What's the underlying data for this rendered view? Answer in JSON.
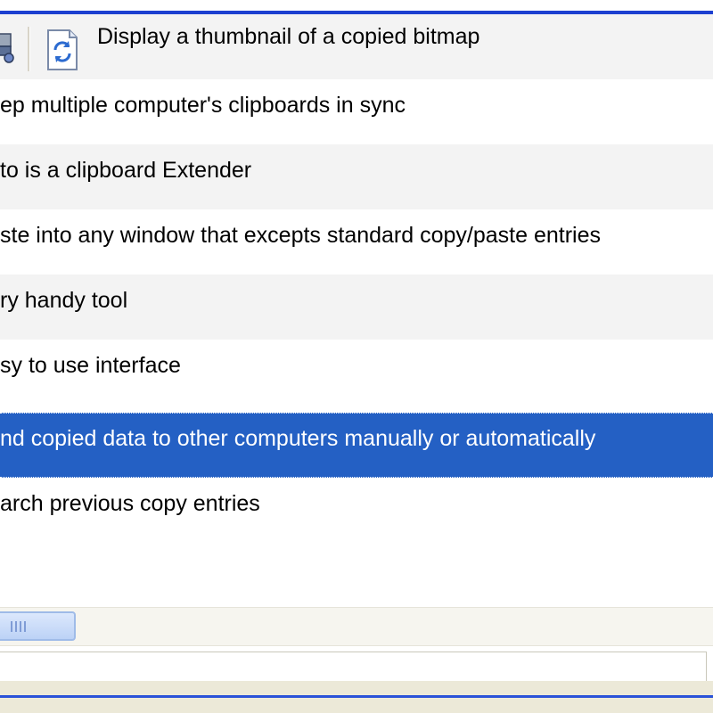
{
  "list": {
    "rows": [
      {
        "text": "Display a thumbnail of a copied bitmap"
      },
      {
        "text": "ep multiple computer's clipboards in sync"
      },
      {
        "text": "to is a clipboard Extender"
      },
      {
        "text": "ste into any window that excepts standard copy/paste entries"
      },
      {
        "text": "ry handy tool"
      },
      {
        "text": "sy to use interface"
      },
      {
        "text": "nd copied data to other computers manually or automatically"
      },
      {
        "text": "arch previous copy entries"
      }
    ],
    "selected_index": 6
  },
  "toolbar": {
    "icons": [
      "printer-icon",
      "refresh-icon"
    ]
  },
  "colors": {
    "selection": "#2460c4",
    "frame_blue": "#1c3fd0",
    "alt_row": "#f3f3f3",
    "scroll_thumb": "#c8daf8"
  }
}
